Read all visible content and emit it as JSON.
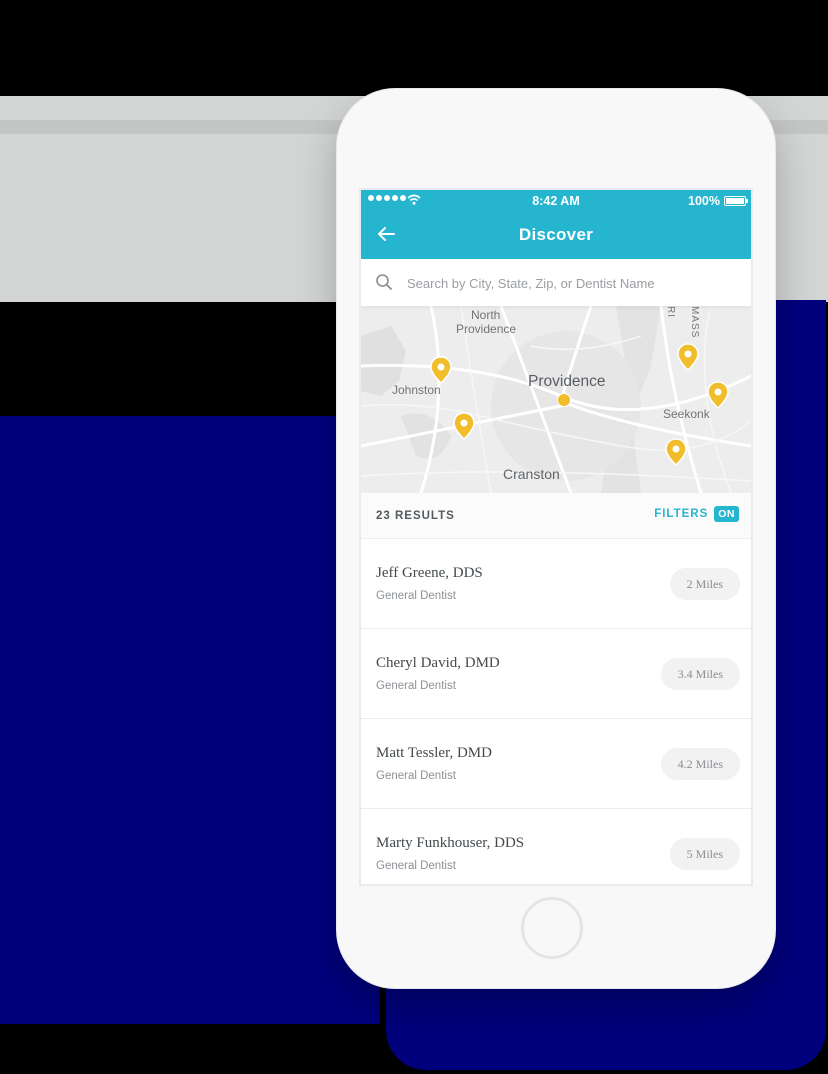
{
  "status_bar": {
    "time": "8:42 AM",
    "battery": "100%"
  },
  "header": {
    "title": "Discover"
  },
  "search": {
    "placeholder": "Search by City, State, Zip, or Dentist Name"
  },
  "map": {
    "labels": {
      "north_providence_line1": "North",
      "north_providence_line2": "Providence",
      "providence": "Providence",
      "johnston": "Johnston",
      "seekonk": "Seekonk",
      "cranston": "Cranston",
      "ri": "RI",
      "mass": "MASS"
    },
    "pin_color": "#f1bd2a"
  },
  "results": {
    "count_label": "23 RESULTS",
    "filters_label": "FILTERS",
    "filters_state": "ON"
  },
  "dentists": [
    {
      "name": "Jeff Greene, DDS",
      "specialty": "General Dentist",
      "distance": "2 Miles"
    },
    {
      "name": "Cheryl David, DMD",
      "specialty": "General Dentist",
      "distance": "3.4 Miles"
    },
    {
      "name": "Matt Tessler, DMD",
      "specialty": "General Dentist",
      "distance": "4.2 Miles"
    },
    {
      "name": "Marty Funkhouser, DDS",
      "specialty": "General Dentist",
      "distance": "5 Miles"
    }
  ],
  "colors": {
    "accent": "#26b5cf",
    "pin": "#f1bd2a"
  }
}
